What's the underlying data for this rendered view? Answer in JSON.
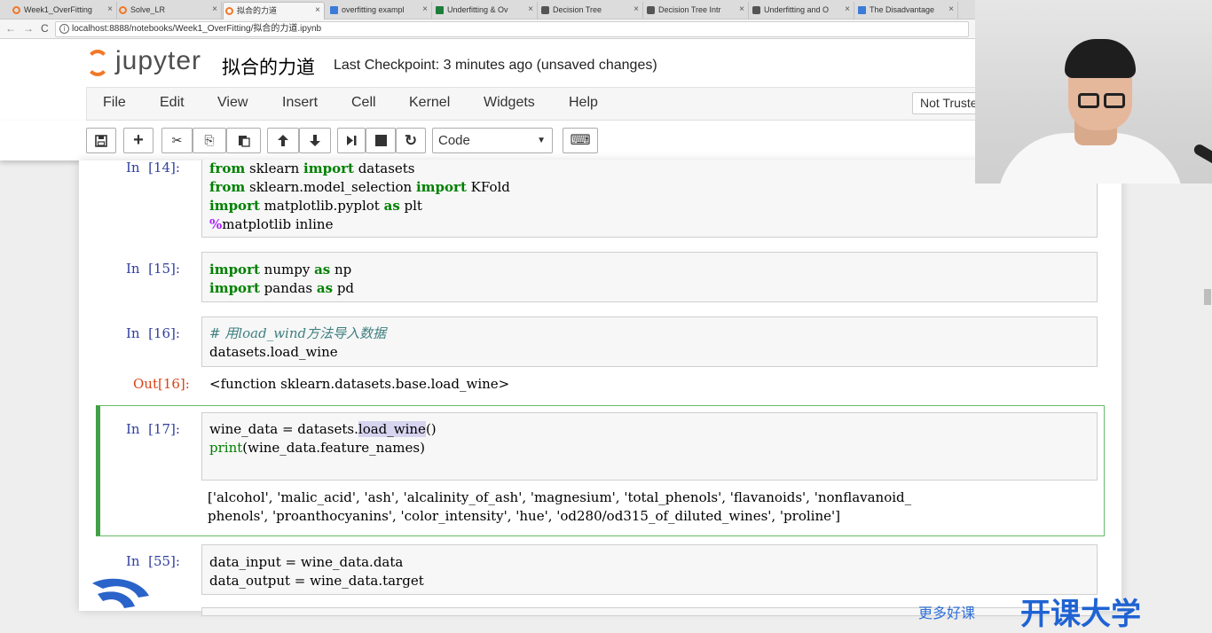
{
  "browser": {
    "tabs": [
      {
        "title": "Week1_OverFitting",
        "icon": "jupyter-icon"
      },
      {
        "title": "Solve_LR",
        "icon": "jupyter-icon"
      },
      {
        "title": "拟合的力道",
        "icon": "jupyter-icon"
      },
      {
        "title": "overfitting exampl",
        "icon": "web-icon"
      },
      {
        "title": "Underfitting & Ov",
        "icon": "sheet-icon"
      },
      {
        "title": "Decision Tree",
        "icon": "doc-icon"
      },
      {
        "title": "Decision Tree Intr",
        "icon": "book-icon"
      },
      {
        "title": "Underfitting and O",
        "icon": "book-icon"
      },
      {
        "title": "The Disadvantage",
        "icon": "web-icon"
      }
    ],
    "tab_close": "×",
    "nav": {
      "back": "←",
      "forward": "→",
      "reload": "C"
    },
    "url": "localhost:8888/notebooks/Week1_OverFitting/拟合的力道.ipynb"
  },
  "header": {
    "logo_text": "jupyter",
    "notebook_title": "拟合的力道",
    "checkpoint": "Last Checkpoint: 3 minutes ago (unsaved changes)"
  },
  "menu": {
    "items": [
      "File",
      "Edit",
      "View",
      "Insert",
      "Cell",
      "Kernel",
      "Widgets",
      "Help"
    ],
    "trust_label": "Not Trusted"
  },
  "toolbar": {
    "save": "save-icon",
    "add": "+",
    "cut": "✂",
    "copy": "⎘",
    "paste": "📋",
    "up": "🡑",
    "down": "🡓",
    "run": "⏭",
    "stop": "■",
    "restart": "↻",
    "cell_type": "Code",
    "keyboard": "⌨"
  },
  "cells": {
    "c14": {
      "prompt": "In  [14]:"
    },
    "c15": {
      "prompt": "In  [15]:"
    },
    "c16": {
      "prompt": "In  [16]:",
      "out_prompt": "Out[16]:",
      "output": "<function sklearn.datasets.base.load_wine>"
    },
    "c17": {
      "prompt": "In  [17]:",
      "output_line1": "['alcohol', 'malic_acid', 'ash', 'alcalinity_of_ash', 'magnesium', 'total_phenols', 'flavanoids', 'nonflavanoid_",
      "output_line2": "phenols', 'proanthocyanins', 'color_intensity', 'hue', 'od280/od315_of_diluted_wines', 'proline']"
    },
    "c55": {
      "prompt": "In  [55]:"
    }
  },
  "watermark": {
    "small_text": "更多好课",
    "big_text": "开课大学"
  },
  "colors": {
    "jupyter_orange": "#f37726",
    "prompt_in": "#303f9f",
    "prompt_out": "#d84315",
    "keyword": "#008000",
    "selected_border": "#42a047"
  }
}
